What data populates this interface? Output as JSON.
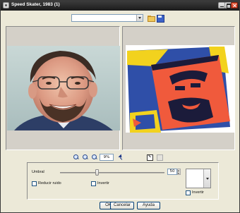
{
  "window": {
    "title": "Speed Skater, 1983 (1)"
  },
  "toolbar": {
    "preset_value": "",
    "zoom_value": "9%"
  },
  "controls": {
    "threshold_label": "Umbral",
    "threshold_value": "50",
    "threshold_slider_fraction": 0.35,
    "reduce_noise_label": "Reducir ruido",
    "invert_label": "Invertir",
    "swatch_invert_label": "Invertir",
    "swatch_color": "#ffffff"
  },
  "buttons": {
    "ok": "OK",
    "cancel": "Cancelar",
    "help": "Ayuda"
  },
  "colors": {
    "titlebar": "#222222",
    "dialog_bg": "#ece9d8",
    "effect_blue": "#2f4fa8",
    "effect_orange": "#f05a3c",
    "effect_yellow": "#f2d21e"
  },
  "icons": [
    "app-icon",
    "chevron-down-icon",
    "folder-icon",
    "save-icon",
    "zoom-in-icon",
    "zoom-out-icon",
    "zoom-fit-icon",
    "pan-icon",
    "compare-icon",
    "reset-icon"
  ]
}
